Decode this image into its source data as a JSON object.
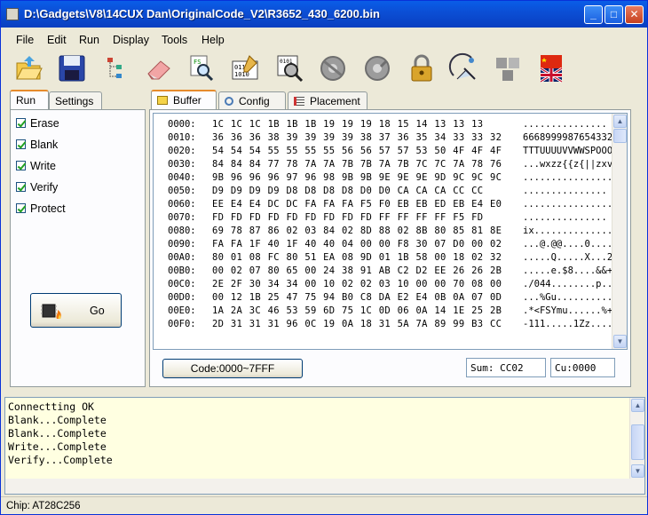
{
  "window": {
    "title": "D:\\Gadgets\\V8\\14CUX Dan\\OriginalCode_V2\\R3652_430_6200.bin"
  },
  "menu": [
    "File",
    "Edit",
    "Run",
    "Display",
    "Tools",
    "Help"
  ],
  "toolbar": {
    "icons": [
      "open-folder-icon",
      "save-disk-icon",
      "tree-icon",
      "eraser-icon",
      "fs-magnify-icon",
      "binary-edit-icon",
      "binary-magnify-icon",
      "disc-gray-icon",
      "disc-gray-2-icon",
      "lock-icon",
      "satellite-icon",
      "puzzle-icon",
      "flags-icon"
    ]
  },
  "left_tabs": [
    "Run",
    "Settings"
  ],
  "options": [
    {
      "label": "Erase",
      "checked": true
    },
    {
      "label": "Blank",
      "checked": true
    },
    {
      "label": "Write",
      "checked": true
    },
    {
      "label": "Verify",
      "checked": true
    },
    {
      "label": "Protect",
      "checked": true
    }
  ],
  "go_label": "Go",
  "right_tabs": [
    "Buffer",
    "Config",
    "Placement"
  ],
  "hex": [
    {
      "addr": "0000:",
      "bytes": "1C 1C 1C 1B 1B 1B 19 19 19 18 15 14 13 13 13",
      "ascii": "..............."
    },
    {
      "addr": "0010:",
      "bytes": "36 36 36 38 39 39 39 39 38 37 36 35 34 33 33 32",
      "ascii": "6668999987654332"
    },
    {
      "addr": "0020:",
      "bytes": "54 54 54 55 55 55 55 56 56 57 57 53 50 4F 4F 4F",
      "ascii": "TTTUUUUVVWWSPOOO"
    },
    {
      "addr": "0030:",
      "bytes": "84 84 84 77 78 7A 7A 7B 7B 7A 7B 7C 7C 7A 78 76",
      "ascii": "...wxzz{{z{||zxv"
    },
    {
      "addr": "0040:",
      "bytes": "9B 96 96 96 97 96 98 9B 9B 9E 9E 9E 9D 9C 9C 9C",
      "ascii": "................"
    },
    {
      "addr": "0050:",
      "bytes": "D9 D9 D9 D9 D8 D8 D8 D8 D0 D0 CA CA CA CC CC",
      "ascii": "..............."
    },
    {
      "addr": "0060:",
      "bytes": "EE E4 E4 DC DC FA FA FA F5 F0 EB EB ED EB E4 E0",
      "ascii": "................"
    },
    {
      "addr": "0070:",
      "bytes": "FD FD FD FD FD FD FD FD FD FF FF FF FF F5 FD",
      "ascii": "..............."
    },
    {
      "addr": "0080:",
      "bytes": "69 78 87 86 02 03 84 02 8D 88 02 8B 80 85 81 8E",
      "ascii": "ix.............."
    },
    {
      "addr": "0090:",
      "bytes": "FA FA 1F 40 1F 40 40 04 00 00 F8 30 07 D0 00 02",
      "ascii": "...@.@@....0...."
    },
    {
      "addr": "00A0:",
      "bytes": "80 01 08 FC 80 51 EA 08 9D 01 1B 58 00 18 02 32",
      "ascii": ".....Q.....X...2"
    },
    {
      "addr": "00B0:",
      "bytes": "00 02 07 80 65 00 24 38 91 AB C2 D2 EE 26 26 2B",
      "ascii": ".....e.$8....&&+"
    },
    {
      "addr": "00C0:",
      "bytes": "2E 2F 30 34 34 00 10 02 02 03 10 00 00 70 08 00",
      "ascii": "./044........p.."
    },
    {
      "addr": "00D0:",
      "bytes": "00 12 1B 25 47 75 94 B0 C8 DA E2 E4 0B 0A 07 0D",
      "ascii": "...%Gu.........."
    },
    {
      "addr": "00E0:",
      "bytes": "1A 2A 3C 46 53 59 6D 75 1C 0D 06 0A 14 1E 25 2B",
      "ascii": ".*<FSYmu......%+"
    },
    {
      "addr": "00F0:",
      "bytes": "2D 31 31 31 96 0C 19 0A 18 31 5A 7A 89 99 B3 CC",
      "ascii": "-111.....1Zz...."
    }
  ],
  "code_button": "Code:0000~7FFF",
  "sum": "Sum:  CC02",
  "cu": "Cu:0000",
  "log": [
    "Connectting OK",
    "Blank...Complete",
    "Blank...Complete",
    "Write...Complete",
    "Verify...Complete"
  ],
  "status": "Chip:  AT28C256"
}
